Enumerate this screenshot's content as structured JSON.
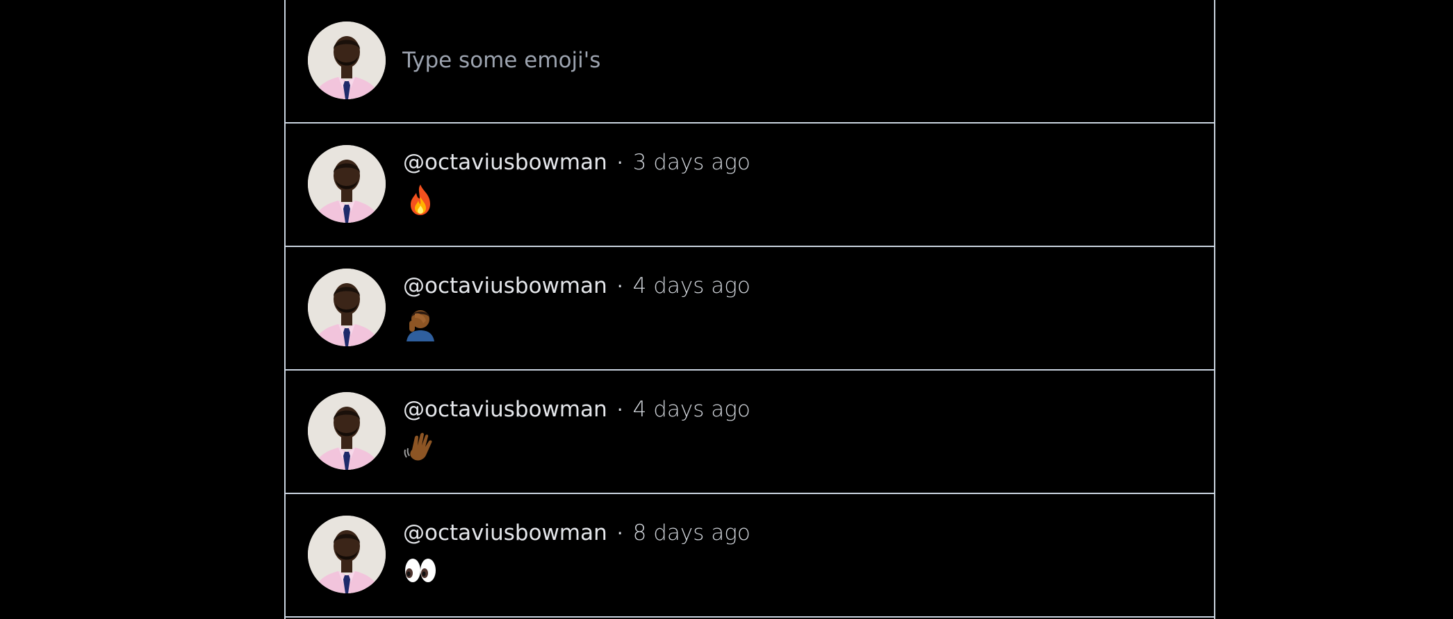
{
  "composer": {
    "placeholder": "Type some emoji's"
  },
  "posts": [
    {
      "username": "@octaviusbowman",
      "separator": "·",
      "time": "3 days ago",
      "emoji": "🔥",
      "emoji_icon": "fire-emoji-icon"
    },
    {
      "username": "@octaviusbowman",
      "separator": "·",
      "time": "4 days ago",
      "emoji": "🤦🏾‍♂️",
      "emoji_icon": "man-facepalming-emoji-icon"
    },
    {
      "username": "@octaviusbowman",
      "separator": "·",
      "time": "4 days ago",
      "emoji": "👋🏾",
      "emoji_icon": "waving-hand-emoji-icon"
    },
    {
      "username": "@octaviusbowman",
      "separator": "·",
      "time": "8 days ago",
      "emoji": "👀",
      "emoji_icon": "eyes-emoji-icon"
    }
  ],
  "colors": {
    "background": "#000000",
    "border": "#cbd5e1",
    "text": "#e5e7eb",
    "placeholder": "#9ca3af"
  }
}
